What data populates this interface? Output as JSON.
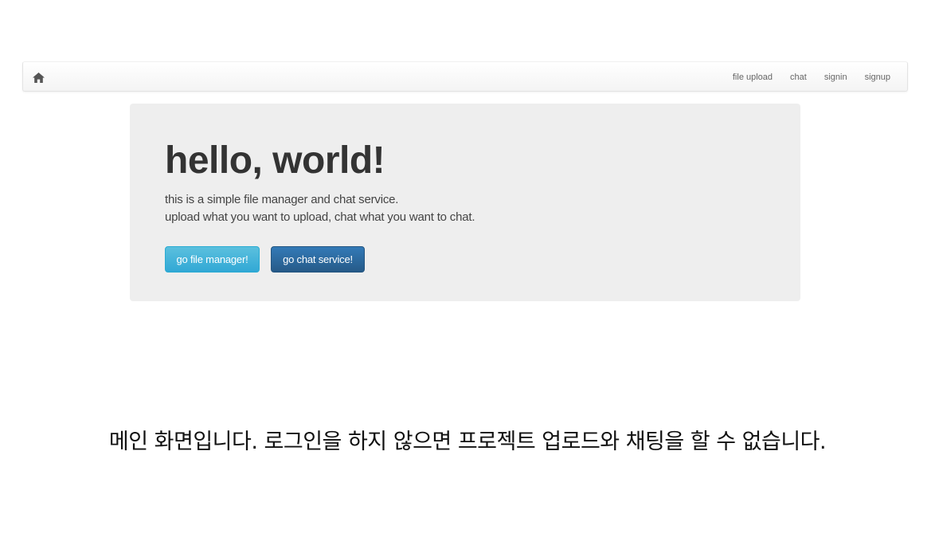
{
  "navbar": {
    "home_icon": "home-icon",
    "links": [
      {
        "label": "file upload"
      },
      {
        "label": "chat"
      },
      {
        "label": "signin"
      },
      {
        "label": "signup"
      }
    ]
  },
  "jumbotron": {
    "title": "hello, world!",
    "lines": [
      "this is a simple file manager and chat service.",
      "upload what you want to upload, chat what you want to chat."
    ],
    "buttons": [
      {
        "label": "go file manager!"
      },
      {
        "label": "go chat service!"
      }
    ]
  },
  "caption": "메인 화면입니다. 로그인을 하지 않으면 프로젝트 업로드와 채팅을 할 수 없습니다.",
  "colors": {
    "background": "#ffffff",
    "jumbotron_bg": "#eeeeee",
    "btn_info": "#5bc0de",
    "btn_primary": "#337ab7"
  }
}
